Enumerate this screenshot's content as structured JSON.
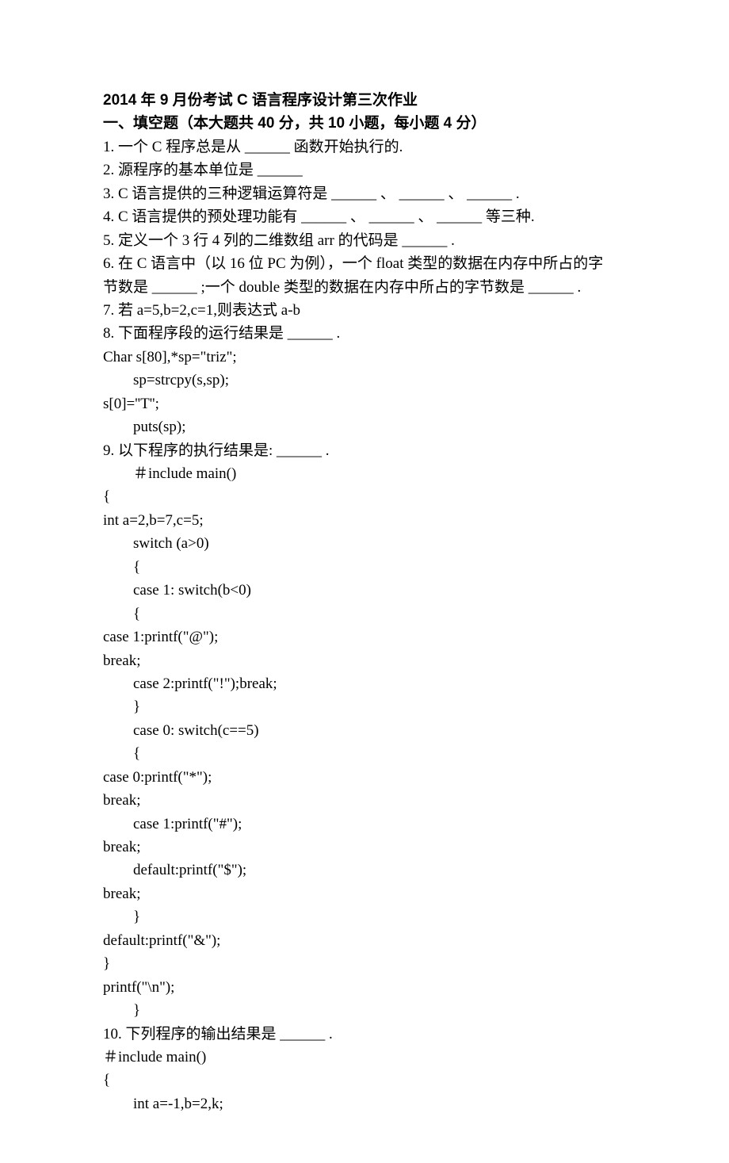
{
  "title": "2014 年 9 月份考试 C 语言程序设计第三次作业",
  "section1": "一、填空题（本大题共 40 分，共 10 小题，每小题 4 分）",
  "lines": {
    "q1": "1. 一个 C 程序总是从 ______ 函数开始执行的.",
    "q2": "2. 源程序的基本单位是 ______",
    "q3": "3. C 语言提供的三种逻辑运算符是 ______ 、 ______ 、 ______ .",
    "q4": "4. C 语言提供的预处理功能有 ______ 、 ______ 、 ______ 等三种.",
    "q5": "5. 定义一个 3 行 4 列的二维数组 arr 的代码是 ______ .",
    "q6a": "6. 在 C 语言中（以 16 位 PC 为例），一个 float 类型的数据在内存中所占的字",
    "q6b": "节数是 ______ ;一个 double 类型的数据在内存中所占的字节数是 ______ .",
    "q7": "7. 若 a=5,b=2,c=1,则表达式 a-b",
    "q8h": "8. 下面程序段的运行结果是 ______ .",
    "q8l1": "Char s[80],*sp=\"triz\";",
    "q8l2": "sp=strcpy(s,sp);",
    "q8l3": "s[0]=''T'';",
    "q8l4": "puts(sp);",
    "q9h": "9. 以下程序的执行结果是: ______ .",
    "q9l1": "＃include main()",
    "q9l2": "{",
    "q9l3": "int a=2,b=7,c=5;",
    "q9l4": "switch (a>0)",
    "q9l5": "{",
    "q9l6": "case 1: switch(b<0)",
    "q9l7": "{",
    "q9l8": "case 1:printf(\"@\");",
    "q9l9": "break;",
    "q9l10": "case 2:printf(\"!\");break;",
    "q9l11": "}",
    "q9l12": "case 0: switch(c==5)",
    "q9l13": "{",
    "q9l14": "case 0:printf(\"*\");",
    "q9l15": "break;",
    "q9l16": "case 1:printf(\"#\");",
    "q9l17": "break;",
    "q9l18": "default:printf(\"$\");",
    "q9l19": "break;",
    "q9l20": "}",
    "q9l21": "default:printf(\"&\");",
    "q9l22": "}",
    "q9l23": "printf(\"\\n\");",
    "q9l24": "}",
    "q10h": "10. 下列程序的输出结果是 ______ .",
    "q10l1": "＃include main()",
    "q10l2": "{",
    "q10l3": "int a=-1,b=2,k;"
  }
}
